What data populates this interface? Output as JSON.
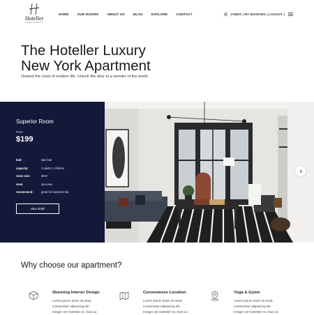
{
  "brand": {
    "name": "Hoteller",
    "tagline": "APARTMENTS"
  },
  "nav": {
    "items": [
      "HOME",
      "OUR ROOMS",
      "ABOUT US",
      "BLOG",
      "EXPLORE",
      "CONTACT"
    ]
  },
  "user": {
    "label": "JAMES | MY BOOKING | LOGOUT |"
  },
  "hero": {
    "title_line1": "The Hoteller Luxury",
    "title_line2": "New York Apartment",
    "subtitle": "Unwind the clock of modern life. Unlock the door to a wonder of the world."
  },
  "room": {
    "name": "Superior Room",
    "from_label": "From",
    "price": "$199",
    "specs": [
      {
        "key": "bed:",
        "value": "twin bed"
      },
      {
        "key": "capacity:",
        "value": "2 adults 1 children"
      },
      {
        "key": "room size:",
        "value": "30m²"
      },
      {
        "key": "view:",
        "value": "sea view"
      },
      {
        "key": "recommend:",
        "value": "great for business trip"
      }
    ],
    "button_label": "view detail"
  },
  "why": {
    "title": "Why choose our apartment?",
    "features": [
      {
        "icon": "cube-icon",
        "title": "Stunning Interior Design",
        "lines": [
          "Lorem ipsum dolor sit amet,",
          "consectetur adipiscing elit.",
          "Integer vel molestie mi. Duis ac"
        ]
      },
      {
        "icon": "map-icon",
        "title": "Convenience Location",
        "lines": [
          "Lorem ipsum dolor sit amet,",
          "consectetur adipiscing elit.",
          "Integer vel molestie mi. Duis ac"
        ]
      },
      {
        "icon": "location-pin-icon",
        "title": "Yoga & Gymn",
        "lines": [
          "Lorem ipsum dolor sit amet,",
          "consectetur adipiscing elit.",
          "Integer vel molestie mi. Duis ac"
        ]
      }
    ]
  },
  "colors": {
    "panel": "#14193a",
    "text": "#1d1d1f",
    "background": "#ffffff"
  }
}
